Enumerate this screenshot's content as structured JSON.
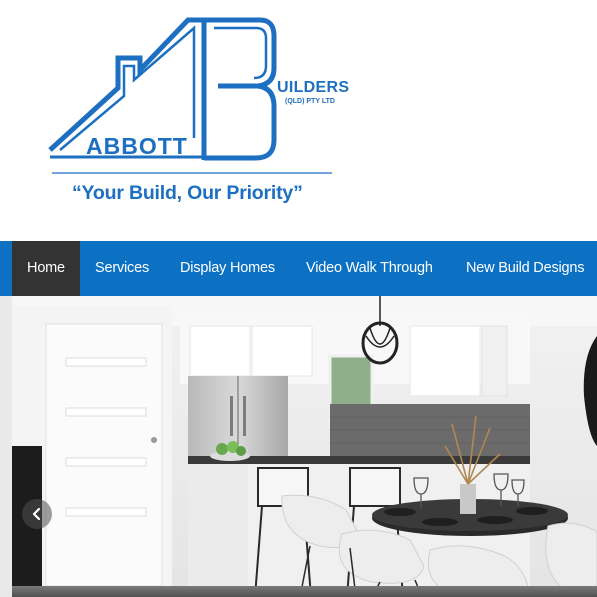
{
  "brand": {
    "logo_initials": "AB",
    "name_main": "ABBOTT",
    "name_suffix": "UILDERS",
    "name_sub": "(QLD) PTY LTD",
    "tagline": "“Your Build, Our Priority”",
    "color_primary": "#1d6fc1"
  },
  "nav": {
    "background": "#0c71c3",
    "active_background": "#333333",
    "items": [
      {
        "label": "Home",
        "active": true
      },
      {
        "label": "Services",
        "active": false
      },
      {
        "label": "Display Homes",
        "active": false
      },
      {
        "label": "Video Walk Through",
        "active": false
      },
      {
        "label": "New Build Designs",
        "active": false
      }
    ]
  },
  "hero": {
    "image": "kitchen-dining-interior",
    "prev_icon": "chevron-left-icon"
  }
}
